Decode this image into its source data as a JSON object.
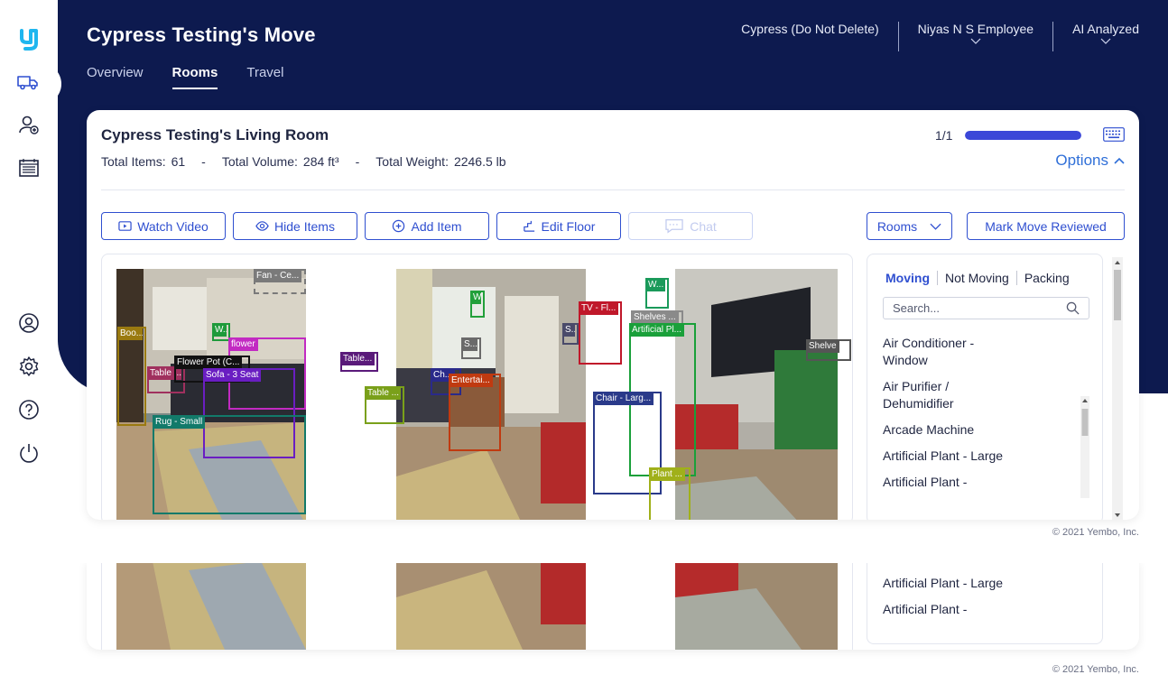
{
  "app": {
    "logo_letter": "y",
    "brand_color": "#1fb6ef",
    "accent_color": "#2f4fd0",
    "header_color": "#0d1a4f"
  },
  "sidebar": {
    "items": [
      {
        "icon": "truck-icon",
        "active": true
      },
      {
        "icon": "add-user-icon"
      },
      {
        "icon": "calendar-icon"
      },
      {
        "icon": "account-icon"
      },
      {
        "icon": "settings-icon"
      },
      {
        "icon": "help-icon"
      },
      {
        "icon": "power-icon"
      }
    ]
  },
  "header": {
    "title": "Cypress Testing's Move",
    "tabs": [
      {
        "label": "Overview",
        "active": false
      },
      {
        "label": "Rooms",
        "active": true
      },
      {
        "label": "Travel",
        "active": false
      }
    ],
    "company": "Cypress (Do Not Delete)",
    "user": "Niyas N S Employee",
    "status": "AI Analyzed"
  },
  "room": {
    "title": "Cypress Testing's Living Room",
    "total_items_label": "Total Items:",
    "total_items": "61",
    "total_volume_label": "Total Volume:",
    "total_volume": "284 ft³",
    "total_weight_label": "Total Weight:",
    "total_weight": "2246.5 lb",
    "pager": "1/1",
    "progress": 1.0,
    "options_label": "Options"
  },
  "toolbar": {
    "watch_video": "Watch Video",
    "hide_items": "Hide Items",
    "add_item": "Add Item",
    "edit_floor": "Edit Floor",
    "chat": "Chat",
    "rooms": "Rooms",
    "mark_reviewed": "Mark Move Reviewed"
  },
  "detections": [
    {
      "label": "Fan - Ce...",
      "color": "#7a7a7a"
    },
    {
      "label": "Boo...",
      "color": "#9a7a10"
    },
    {
      "label": "W...",
      "color": "#1e9a3a"
    },
    {
      "label": "flower",
      "color": "#c22ac2"
    },
    {
      "label": "Table ...",
      "color": "#a0305e"
    },
    {
      "label": "Flower Pot (C...",
      "color": "#111111"
    },
    {
      "label": "Sofa - 3 Seat",
      "color": "#6a1ec2"
    },
    {
      "label": "Rug - Small",
      "color": "#127a6a"
    },
    {
      "label": "Table...",
      "color": "#5a1a7a"
    },
    {
      "label": "Table ...",
      "color": "#7aa01a"
    },
    {
      "label": "W...",
      "color": "#22a03a"
    },
    {
      "label": "S...",
      "color": "#6a6a6a"
    },
    {
      "label": "Ch...",
      "color": "#2a2a8a"
    },
    {
      "label": "Entertai...",
      "color": "#c03a10"
    },
    {
      "label": "TV - Fl...",
      "color": "#c0182a"
    },
    {
      "label": "S...",
      "color": "#4a4a6a"
    },
    {
      "label": "W...",
      "color": "#1a9a5a"
    },
    {
      "label": "Shelves ...",
      "color": "#8a8a8a"
    },
    {
      "label": "Artificial Pl...",
      "color": "#1aa03a"
    },
    {
      "label": "Chair - Larg...",
      "color": "#2a3a8a"
    },
    {
      "label": "Plant ...",
      "color": "#a0b01a"
    },
    {
      "label": "Shelve",
      "color": "#555555"
    }
  ],
  "item_panel": {
    "tabs": [
      "Moving",
      "Not Moving",
      "Packing"
    ],
    "search_placeholder": "Search...",
    "items": [
      "Air Conditioner - Window",
      "Air Purifier / Dehumidifier",
      "Arcade Machine",
      "Artificial Plant - Large",
      "Artificial Plant -"
    ],
    "ghost_items": [
      "Artificial Plant - Large",
      "Artificial Plant -"
    ]
  },
  "footer": {
    "copyright": "© 2021 Yembo, Inc."
  }
}
